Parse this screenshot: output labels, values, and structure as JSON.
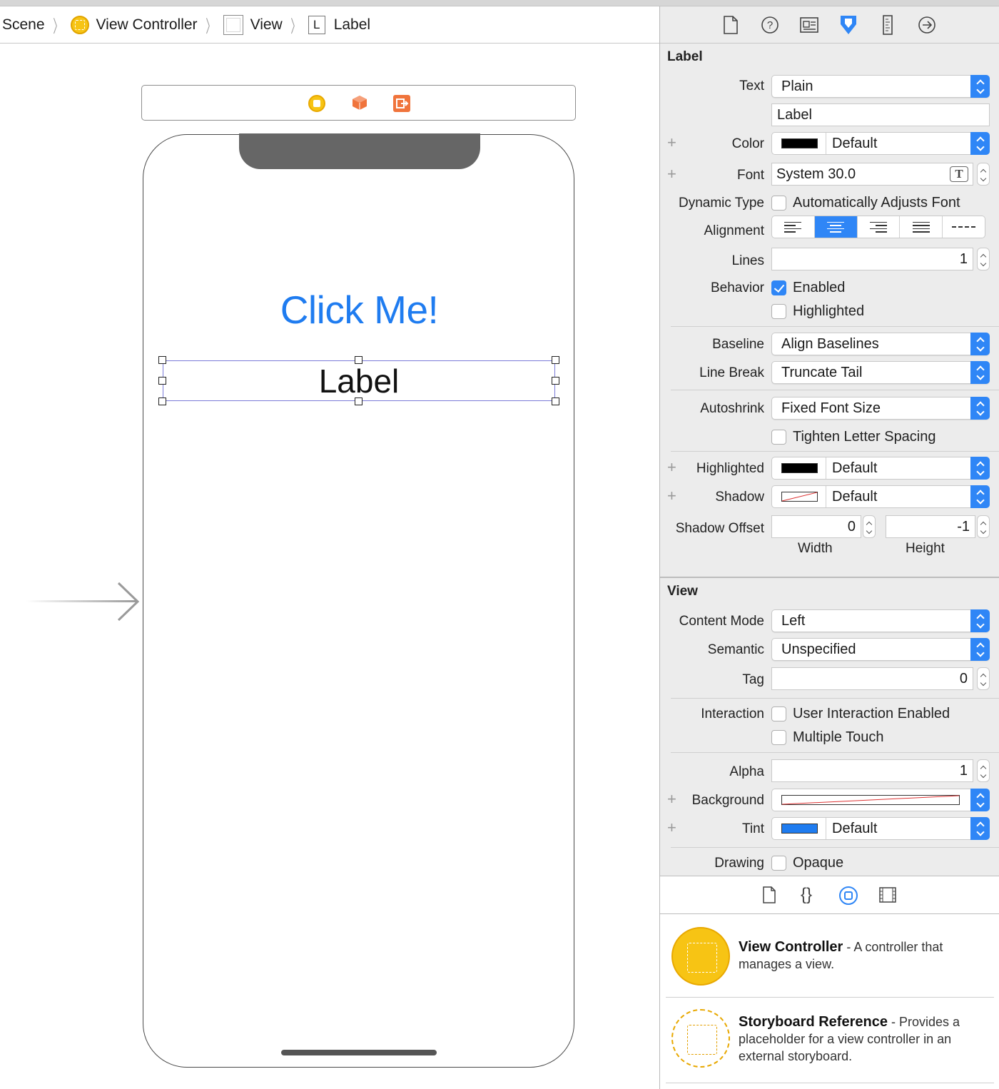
{
  "jumpbar": {
    "items": [
      {
        "label": "Scene"
      },
      {
        "label": "View Controller",
        "icon": "view-controller-icon"
      },
      {
        "label": "View",
        "icon": "view-icon"
      },
      {
        "label": "Label",
        "icon_glyph": "L"
      }
    ]
  },
  "scene": {
    "button_title": "Click Me!",
    "label_text": "Label"
  },
  "inspector": {
    "tabs": [
      "file-inspector-icon",
      "quick-help-icon",
      "identity-inspector-icon",
      "attributes-inspector-icon",
      "size-inspector-icon",
      "connections-inspector-icon"
    ],
    "label_section": {
      "title": "Label",
      "text_label": "Text",
      "text_type": "Plain",
      "text_value": "Label",
      "color_label": "Color",
      "color_value": "Default",
      "font_label": "Font",
      "font_value": "System 30.0",
      "dynamic_type_label": "Dynamic Type",
      "dynamic_type_option": "Automatically Adjusts Font",
      "alignment_label": "Alignment",
      "lines_label": "Lines",
      "lines_value": "1",
      "behavior_label": "Behavior",
      "enabled_label": "Enabled",
      "highlighted_check_label": "Highlighted",
      "baseline_label": "Baseline",
      "baseline_value": "Align Baselines",
      "line_break_label": "Line Break",
      "line_break_value": "Truncate Tail",
      "autoshrink_label": "Autoshrink",
      "autoshrink_value": "Fixed Font Size",
      "tighten_label": "Tighten Letter Spacing",
      "highlighted_label": "Highlighted",
      "highlighted_value": "Default",
      "shadow_label": "Shadow",
      "shadow_value": "Default",
      "shadow_offset_label": "Shadow Offset",
      "shadow_width": "0",
      "shadow_height": "-1",
      "width_label": "Width",
      "height_label": "Height"
    },
    "view_section": {
      "title": "View",
      "content_mode_label": "Content Mode",
      "content_mode_value": "Left",
      "semantic_label": "Semantic",
      "semantic_value": "Unspecified",
      "tag_label": "Tag",
      "tag_value": "0",
      "interaction_label": "Interaction",
      "user_interaction_label": "User Interaction Enabled",
      "multiple_touch_label": "Multiple Touch",
      "alpha_label": "Alpha",
      "alpha_value": "1",
      "background_label": "Background",
      "tint_label": "Tint",
      "tint_value": "Default",
      "drawing_label": "Drawing",
      "opaque_label": "Opaque"
    },
    "library": {
      "tabs": [
        "file-template-icon",
        "code-snippet-icon",
        "object-library-icon",
        "media-library-icon"
      ],
      "items": [
        {
          "name": "View Controller",
          "description": " - A controller that manages a view."
        },
        {
          "name": "Storyboard Reference",
          "description": " - Provides a placeholder for a view controller in an external storyboard."
        }
      ]
    }
  },
  "colors": {
    "accent": "#2f86f6",
    "button_text": "#1f7cf0",
    "view_controller": "#f7c414",
    "tint_swatch": "#1f7cf0"
  }
}
